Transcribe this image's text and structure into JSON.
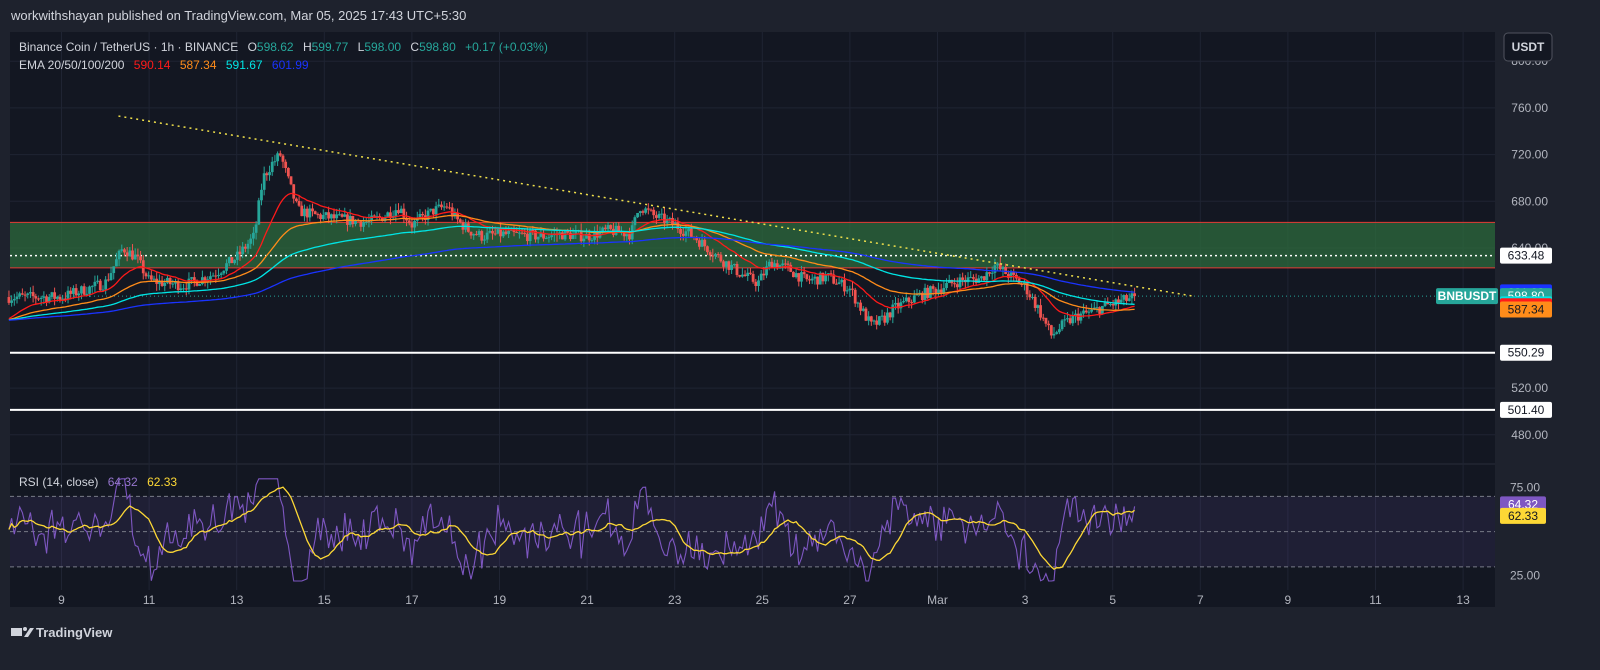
{
  "publish_line": "workwithshayan published on TradingView.com, Mar 05, 2025 17:43 UTC+5:30",
  "footer": {
    "brand": "TradingView"
  },
  "currency_button": "USDT",
  "header": {
    "symbol": "Binance Coin / TetherUS · 1h · BINANCE",
    "o_label": "O",
    "o_value": "598.62",
    "h_label": "H",
    "h_value": "599.77",
    "l_label": "L",
    "l_value": "598.00",
    "c_label": "C",
    "c_value": "598.80",
    "change": "+0.17 (+0.03%)"
  },
  "ema_legend": {
    "label": "EMA 20/50/100/200",
    "values": [
      "590.14",
      "587.34",
      "591.67",
      "601.99"
    ]
  },
  "rsi_legend": {
    "label": "RSI (14, close)",
    "rsi": "64.32",
    "ma": "62.33"
  },
  "colors": {
    "background": "#131722",
    "frame": "#1e222d",
    "up": "#26a69a",
    "down": "#ef5350",
    "ema20": "#ff1a1a",
    "ema50": "#ff8c1a",
    "ema100": "#00e5e5",
    "ema200": "#1a33ff",
    "zone": "#2e6b3e",
    "trend": "#f0e04b",
    "rsi": "#7e57c2",
    "rsi_ma": "#fdd835"
  },
  "chart_data": [
    {
      "type": "candlestick",
      "symbol": "BNBUSDT",
      "timeframe": "1h",
      "x_tick_labels": [
        "9",
        "11",
        "13",
        "15",
        "17",
        "19",
        "21",
        "23",
        "25",
        "27",
        "Mar",
        "3",
        "5",
        "7",
        "9",
        "11",
        "13"
      ],
      "x_range_days": [
        "2025-02-08",
        "2025-03-14"
      ],
      "y_tick_labels": [
        "800.00",
        "760.00",
        "720.00",
        "680.00",
        "640.00",
        "520.00",
        "480.00"
      ],
      "ylim": [
        455,
        825
      ],
      "close_path": [
        [
          0,
          598
        ],
        [
          1,
          610
        ],
        [
          1.4,
          640
        ],
        [
          1.7,
          632
        ],
        [
          2,
          612
        ],
        [
          2.8,
          608
        ],
        [
          3.5,
          618
        ],
        [
          4,
          632
        ],
        [
          4.4,
          650
        ],
        [
          4.6,
          700
        ],
        [
          4.8,
          712
        ],
        [
          5,
          720
        ],
        [
          5.2,
          695
        ],
        [
          5.4,
          672
        ],
        [
          5.8,
          668
        ],
        [
          6.3,
          665
        ],
        [
          7,
          662
        ],
        [
          7.4,
          668
        ],
        [
          7.7,
          675
        ],
        [
          8,
          660
        ],
        [
          8.5,
          672
        ],
        [
          8.8,
          676
        ],
        [
          9,
          665
        ],
        [
          9.3,
          655
        ],
        [
          9.6,
          650
        ],
        [
          10,
          652
        ],
        [
          11,
          650
        ],
        [
          11.4,
          652
        ],
        [
          12,
          650
        ],
        [
          12.5,
          655
        ],
        [
          13,
          652
        ],
        [
          13.2,
          676
        ],
        [
          13.5,
          668
        ],
        [
          14,
          660
        ],
        [
          14.5,
          648
        ],
        [
          15,
          632
        ],
        [
          15.5,
          618
        ],
        [
          15.9,
          610
        ],
        [
          16.2,
          628
        ],
        [
          16.6,
          622
        ],
        [
          17,
          612
        ],
        [
          17.5,
          615
        ],
        [
          18,
          605
        ],
        [
          18.3,
          585
        ],
        [
          18.5,
          573
        ],
        [
          18.8,
          580
        ],
        [
          19,
          588
        ],
        [
          19.5,
          598
        ],
        [
          20,
          605
        ],
        [
          20.5,
          612
        ],
        [
          21,
          614
        ],
        [
          21.3,
          625
        ],
        [
          21.7,
          615
        ],
        [
          22,
          607
        ],
        [
          22.3,
          588
        ],
        [
          22.6,
          565
        ],
        [
          22.9,
          575
        ],
        [
          23.2,
          582
        ],
        [
          23.5,
          585
        ],
        [
          23.8,
          590
        ],
        [
          24,
          592
        ],
        [
          24.5,
          598
        ]
      ],
      "ema_series": [
        {
          "name": "EMA 20",
          "last": 590.14
        },
        {
          "name": "EMA 50",
          "last": 587.34
        },
        {
          "name": "EMA 100",
          "last": 591.67
        },
        {
          "name": "EMA 200",
          "last": 601.99
        }
      ],
      "zone": [
        623,
        662
      ],
      "dotted_level": 633.48,
      "horizontal_levels": [
        550.29,
        501.4
      ],
      "trendline": {
        "from": [
          1.3,
          753
        ],
        "to": [
          25.8,
          599
        ]
      },
      "last_price": 598.8,
      "price_badges": [
        {
          "text": "633.48",
          "value": 633.48,
          "bg": "#ffffff",
          "fg": "#131722"
        },
        {
          "text": "601.99",
          "value": 601.99,
          "bg": "#1a33ff",
          "fg": "#ffffff"
        },
        {
          "text": "BNBUSDT",
          "value": 598.8,
          "bg": "#26a69a",
          "fg": "#ffffff"
        },
        {
          "text": "598.80",
          "value": 598.8,
          "bg": "#26a69a",
          "fg": "#ffffff"
        },
        {
          "text": "591.67",
          "value": 591.67,
          "bg": "#00e5e5",
          "fg": "#131722"
        },
        {
          "text": "590.14",
          "value": 590.14,
          "bg": "#ff1a1a",
          "fg": "#ffffff"
        },
        {
          "text": "587.34",
          "value": 587.34,
          "bg": "#ff8c1a",
          "fg": "#131722"
        },
        {
          "text": "550.29",
          "value": 550.29,
          "bg": "#ffffff",
          "fg": "#131722"
        },
        {
          "text": "501.40",
          "value": 501.4,
          "bg": "#ffffff",
          "fg": "#131722"
        }
      ]
    },
    {
      "type": "line",
      "title": "RSI (14, close)",
      "y_tick_labels": [
        "75.00",
        "25.00"
      ],
      "ylim": [
        18,
        85
      ],
      "bands": [
        70,
        50,
        30
      ],
      "last_rsi": 64.32,
      "last_ma": 62.33
    }
  ]
}
